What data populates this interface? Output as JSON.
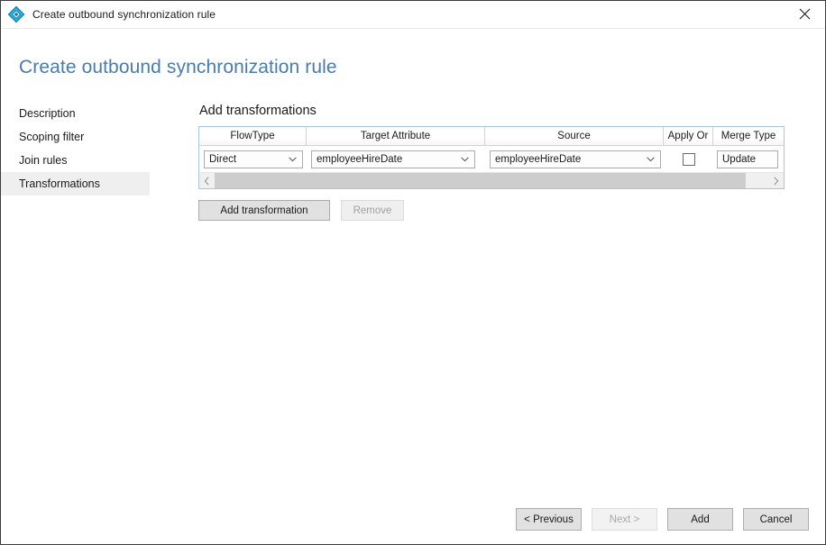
{
  "window": {
    "titlebar_title": "Create outbound synchronization rule",
    "close_icon": "close-icon",
    "app_icon": "diamond-rule-icon",
    "accent_color": "#4a7bae",
    "icon_color": "#1aa8e0"
  },
  "page": {
    "heading": "Create outbound synchronization rule"
  },
  "nav": {
    "items": [
      {
        "label": "Description",
        "selected": false
      },
      {
        "label": "Scoping filter",
        "selected": false
      },
      {
        "label": "Join rules",
        "selected": false
      },
      {
        "label": "Transformations",
        "selected": true
      }
    ]
  },
  "main": {
    "section_title": "Add transformations",
    "grid": {
      "columns": [
        {
          "header": "FlowType"
        },
        {
          "header": "Target Attribute"
        },
        {
          "header": "Source"
        },
        {
          "header": "Apply Or"
        },
        {
          "header": "Merge Type"
        }
      ],
      "rows": [
        {
          "flow_type": "Direct",
          "target_attribute": "employeeHireDate",
          "source": "employeeHireDate",
          "apply_once_checked": false,
          "merge_type": "Update"
        }
      ],
      "scrollbar": {
        "left_arrow": "chevron-left-icon",
        "right_arrow": "chevron-right-icon"
      }
    },
    "buttons": {
      "add_transformation": "Add transformation",
      "remove": "Remove"
    }
  },
  "footer": {
    "previous": "< Previous",
    "next": "Next >",
    "add": "Add",
    "cancel": "Cancel"
  }
}
